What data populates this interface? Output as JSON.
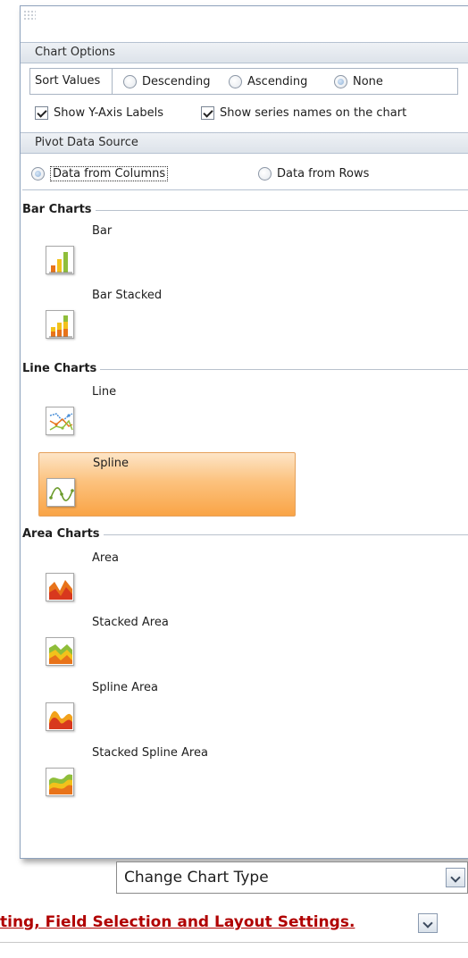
{
  "chart_options": {
    "header": "Chart Options",
    "sort_values": {
      "label": "Sort Values",
      "options": [
        {
          "label": "Descending",
          "checked": false
        },
        {
          "label": "Ascending",
          "checked": false
        },
        {
          "label": "None",
          "checked": true
        }
      ]
    },
    "checkboxes": [
      {
        "label": "Show Y-Axis Labels",
        "checked": true
      },
      {
        "label": "Show series names on the chart",
        "checked": true
      }
    ]
  },
  "pivot_source": {
    "header": "Pivot Data Source",
    "options": [
      {
        "label": "Data from Columns",
        "checked": true
      },
      {
        "label": "Data from Rows",
        "checked": false
      }
    ]
  },
  "gallery": {
    "groups": [
      {
        "title": "Bar Charts",
        "items": [
          {
            "label": "Bar",
            "icon": "bar-chart-icon",
            "selected": false
          },
          {
            "label": "Bar Stacked",
            "icon": "stacked-bar-chart-icon",
            "selected": false
          }
        ]
      },
      {
        "title": "Line Charts",
        "items": [
          {
            "label": "Line",
            "icon": "line-chart-icon",
            "selected": false
          },
          {
            "label": "Spline",
            "icon": "spline-chart-icon",
            "selected": true
          }
        ]
      },
      {
        "title": "Area Charts",
        "items": [
          {
            "label": "Area",
            "icon": "area-chart-icon",
            "selected": false
          },
          {
            "label": "Stacked Area",
            "icon": "stacked-area-chart-icon",
            "selected": false
          },
          {
            "label": "Spline Area",
            "icon": "spline-area-chart-icon",
            "selected": false
          },
          {
            "label": "Stacked Spline Area",
            "icon": "stacked-spline-area-chart-icon",
            "selected": false
          }
        ]
      }
    ]
  },
  "change_chart_type": {
    "label": "Change Chart Type"
  },
  "settings_link": {
    "label": "ting, Field Selection and Layout Settings."
  },
  "colors": {
    "selected_start": "#fde5c7",
    "selected_end": "#f9a446",
    "link": "#b00000"
  }
}
